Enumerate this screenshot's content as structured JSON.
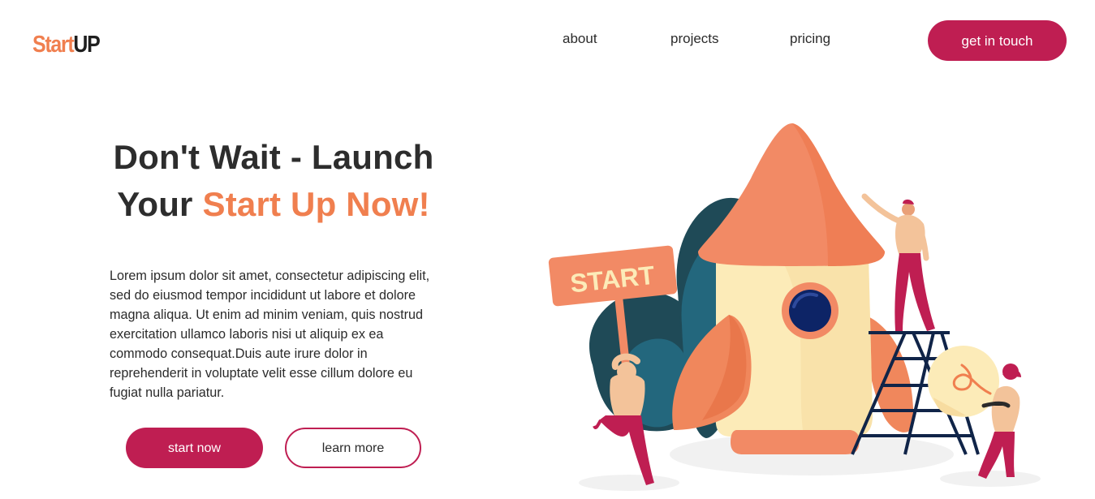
{
  "brand": {
    "logo_part1": "Start",
    "logo_part2": "UP"
  },
  "nav": {
    "about": "about",
    "projects": "projects",
    "pricing": "pricing",
    "cta": "get in touch"
  },
  "hero": {
    "headline_line1": "Don't Wait - Launch",
    "headline_line2_prefix": "Your ",
    "headline_line2_highlight": "Start Up Now!",
    "body": "Lorem ipsum dolor sit amet, consectetur adipiscing elit, sed do eiusmod tempor incididunt ut labore et dolore magna aliqua. Ut enim ad minim veniam, quis nostrud exercitation ullamco laboris nisi ut aliquip ex ea commodo consequat.Duis aute irure dolor in reprehenderit in voluptate velit esse cillum dolore eu fugiat nulla pariatur.",
    "primary_button": "start now",
    "secondary_button": "learn more"
  },
  "illustration": {
    "sign_text": "START"
  },
  "colors": {
    "accent_orange": "#f07f4f",
    "brand_crimson": "#bf1e52",
    "text_dark": "#2b2b2b",
    "rocket_cream": "#fcebb8",
    "teal_dark": "#1f4a57"
  },
  "icons": [
    "rocket-illustration",
    "lightbulb-icon"
  ]
}
